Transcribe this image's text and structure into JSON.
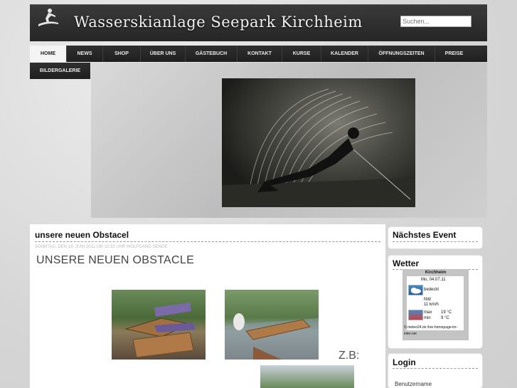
{
  "header": {
    "title": "Wasserskianlage Seepark Kirchheim",
    "search_placeholder": "Suchen..."
  },
  "nav": {
    "items": [
      "Home",
      "News",
      "Shop",
      "Über uns",
      "Gästebuch",
      "Kontakt",
      "Kurse",
      "Kalender",
      "Öffnungszeiten",
      "Preise"
    ],
    "second_row": [
      "Bildergalerie"
    ],
    "active": "Home"
  },
  "post": {
    "title": "unsere neuen Obstacel",
    "meta": "SONNTAG, DEN 19. JUNI 2011 UM 10:33 UHR WOLFGANG SENGE",
    "heading": "UNSERE NEUEN OBSTACLE",
    "zb_label": "Z.B:"
  },
  "sidebar": {
    "event_title": "Nächstes Event",
    "weather_title": "Wetter",
    "login_title": "Login",
    "username_label": "Benutzername"
  },
  "weather": {
    "location": "Kirchheim",
    "date": "Mo, 04.07.11",
    "condition": "bedeckt",
    "wind_dir": "NW",
    "wind_speed": "11 km/h",
    "max_label": "max",
    "max_value": "19 °C",
    "min_label": "min",
    "min_value": "9 °C",
    "source": "© meteo24.de ihre-homepage-im-inter.net"
  },
  "colors": {
    "header_bg": "#2e2e2e",
    "nav_active_bg": "#f4f4f4",
    "page_bg": "#dcdcdc"
  }
}
